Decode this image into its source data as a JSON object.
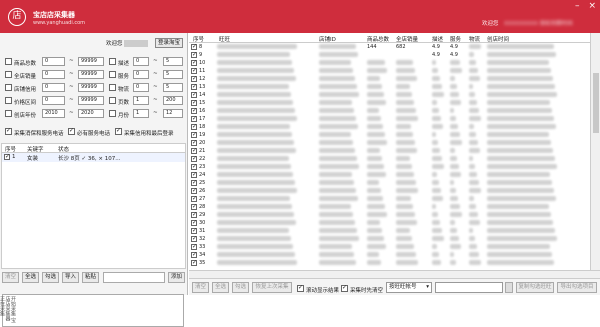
{
  "window": {
    "logo_char": "店",
    "title": "宝店店采集器",
    "url": "www.yanghuadi.com",
    "welcome": "欢迎您",
    "welcome_blur": "XXXXXXXXX 授权到期时间"
  },
  "left": {
    "user_label": "欢迎您",
    "login_button": "登录淘宝",
    "filters": [
      {
        "label": "商品总数",
        "min": "0",
        "max": "99999",
        "label2": "描述",
        "min2": "0",
        "max2": "5"
      },
      {
        "label": "全店销量",
        "min": "0",
        "max": "99999",
        "label2": "服务",
        "min2": "0",
        "max2": "5"
      },
      {
        "label": "店铺信用",
        "min": "0",
        "max": "99999",
        "label2": "物流",
        "min2": "0",
        "max2": "5"
      },
      {
        "label": "价格区间",
        "min": "0",
        "max": "99999",
        "label2": "页数",
        "min2": "1",
        "max2": "200"
      },
      {
        "label": "创店年份",
        "min": "2010",
        "max": "2020",
        "label2": "月份",
        "min2": "1",
        "max2": "12"
      }
    ],
    "options": [
      "采集消保和服务电话",
      "必有服务电话",
      "采集信用和最后登录"
    ],
    "kw_headers": {
      "index": "序号",
      "keyword": "关键字",
      "status": "状态"
    },
    "keywords": [
      {
        "index": "1",
        "keyword": "女装",
        "status": "长沙 8页 ✓ 36, × 107..."
      }
    ],
    "buttons": {
      "clear": "清空",
      "select_all": "全选",
      "check": "勾选",
      "import": "导入",
      "paste": "粘贴",
      "add": "添加"
    },
    "log_text": "开始采集 宝店店采集器 正在采集"
  },
  "right": {
    "headers": [
      "序号",
      "旺旺",
      "店铺ID",
      "商品总数",
      "全店销量",
      "描述",
      "服务",
      "物流",
      "创店时间"
    ],
    "first_row": {
      "index": "8",
      "shop_id": "...7",
      "goods": "144",
      "sales": "682",
      "desc": "4.9",
      "service": "4.9"
    },
    "second_row": {
      "goods": "",
      "sales": "",
      "desc": "4.9",
      "service": "4.9"
    },
    "row_numbers": [
      "8",
      "9",
      "10",
      "11",
      "12",
      "13",
      "14",
      "15",
      "16",
      "17",
      "18",
      "19",
      "20",
      "21",
      "22",
      "23",
      "24",
      "25",
      "26",
      "27",
      "28",
      "29",
      "30",
      "31",
      "32",
      "33",
      "34",
      "35"
    ],
    "bottom": {
      "clear": "清空",
      "select_all": "全选",
      "check": "勾选",
      "resume": "恢复上次采集",
      "auto_show": "滚动显示结果",
      "clear_on_start": "采集时先清空",
      "select_value": "按旺旺帐号",
      "copy": "复制勾选旺旺",
      "export": "导出勾选项目"
    }
  }
}
